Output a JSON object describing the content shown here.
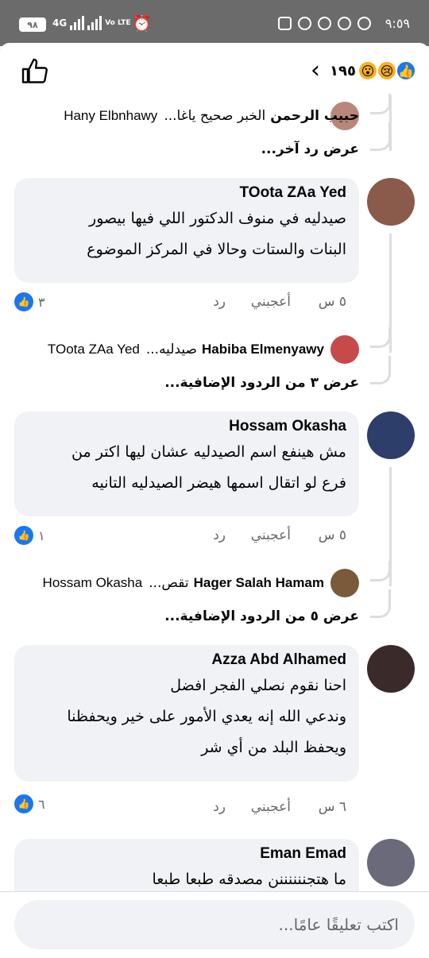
{
  "status_bar": {
    "battery": "٩٨",
    "network": "4G",
    "volte": "Vo LTE",
    "time": "٩:٥٩"
  },
  "header": {
    "reaction_count": "١٩٥",
    "reactions": [
      "wow",
      "sad",
      "like"
    ],
    "back_icon": "chevron-left-icon",
    "like_icon": "thumbs-up-outline-icon"
  },
  "thread0": {
    "reply": {
      "name": "حبيب الرحمن",
      "snippet": "الخبر صحيح ياغا...",
      "mention": "Hany Elbnhawy"
    },
    "more": "عرض رد آخر..."
  },
  "comments": [
    {
      "name": "TOota ZAa Yed",
      "lines": [
        "صيدليه في منوف الدكتور اللي فيها بيصور",
        "البنات والستات وحالا في المركز الموضوع"
      ],
      "time": "٥ س",
      "like": "أعجبني",
      "reply": "رد",
      "count": "٣",
      "avatar_color": "#8a5a4a",
      "subreply": {
        "name": "Habiba Elmenyawy",
        "snippet": "صيدليه...",
        "mention": "TOota ZAa Yed"
      },
      "more": "عرض ٣ من الردود الإضافية..."
    },
    {
      "name": "Hossam Okasha",
      "lines": [
        "مش هينفع اسم الصيدليه عشان ليها اكتر من",
        "فرع لو اتقال اسمها هيضر الصيدليه التانيه"
      ],
      "time": "٥ س",
      "like": "أعجبني",
      "reply": "رد",
      "count": "١",
      "avatar_color": "#2d3e6b",
      "subreply": {
        "name": "Hager Salah Hamam",
        "snippet": "تقص...",
        "mention": "Hossam Okasha"
      },
      "more": "عرض ٥ من الردود الإضافية..."
    },
    {
      "name": "Azza Abd Alhamed",
      "lines": [
        "احنا نقوم نصلي الفجر افضل",
        "وندعي الله إنه يعدي الأمور على خير ويحفظنا",
        "ويحفظ البلد من أي شر"
      ],
      "time": "٦ س",
      "like": "أعجبني",
      "reply": "رد",
      "count": "٦",
      "avatar_color": "#3a2a2a"
    },
    {
      "name": "Eman Emad",
      "lines": [
        "ما هتجننننننن مصدقه طبعا طبعا"
      ],
      "avatar_color": "#6a6a7a"
    }
  ],
  "composer": {
    "placeholder": "اكتب تعليقًا عامًا..."
  },
  "colors": {
    "accent": "#1877f2",
    "bubble": "#f0f2f5",
    "status_bar": "#6b6b6b"
  }
}
